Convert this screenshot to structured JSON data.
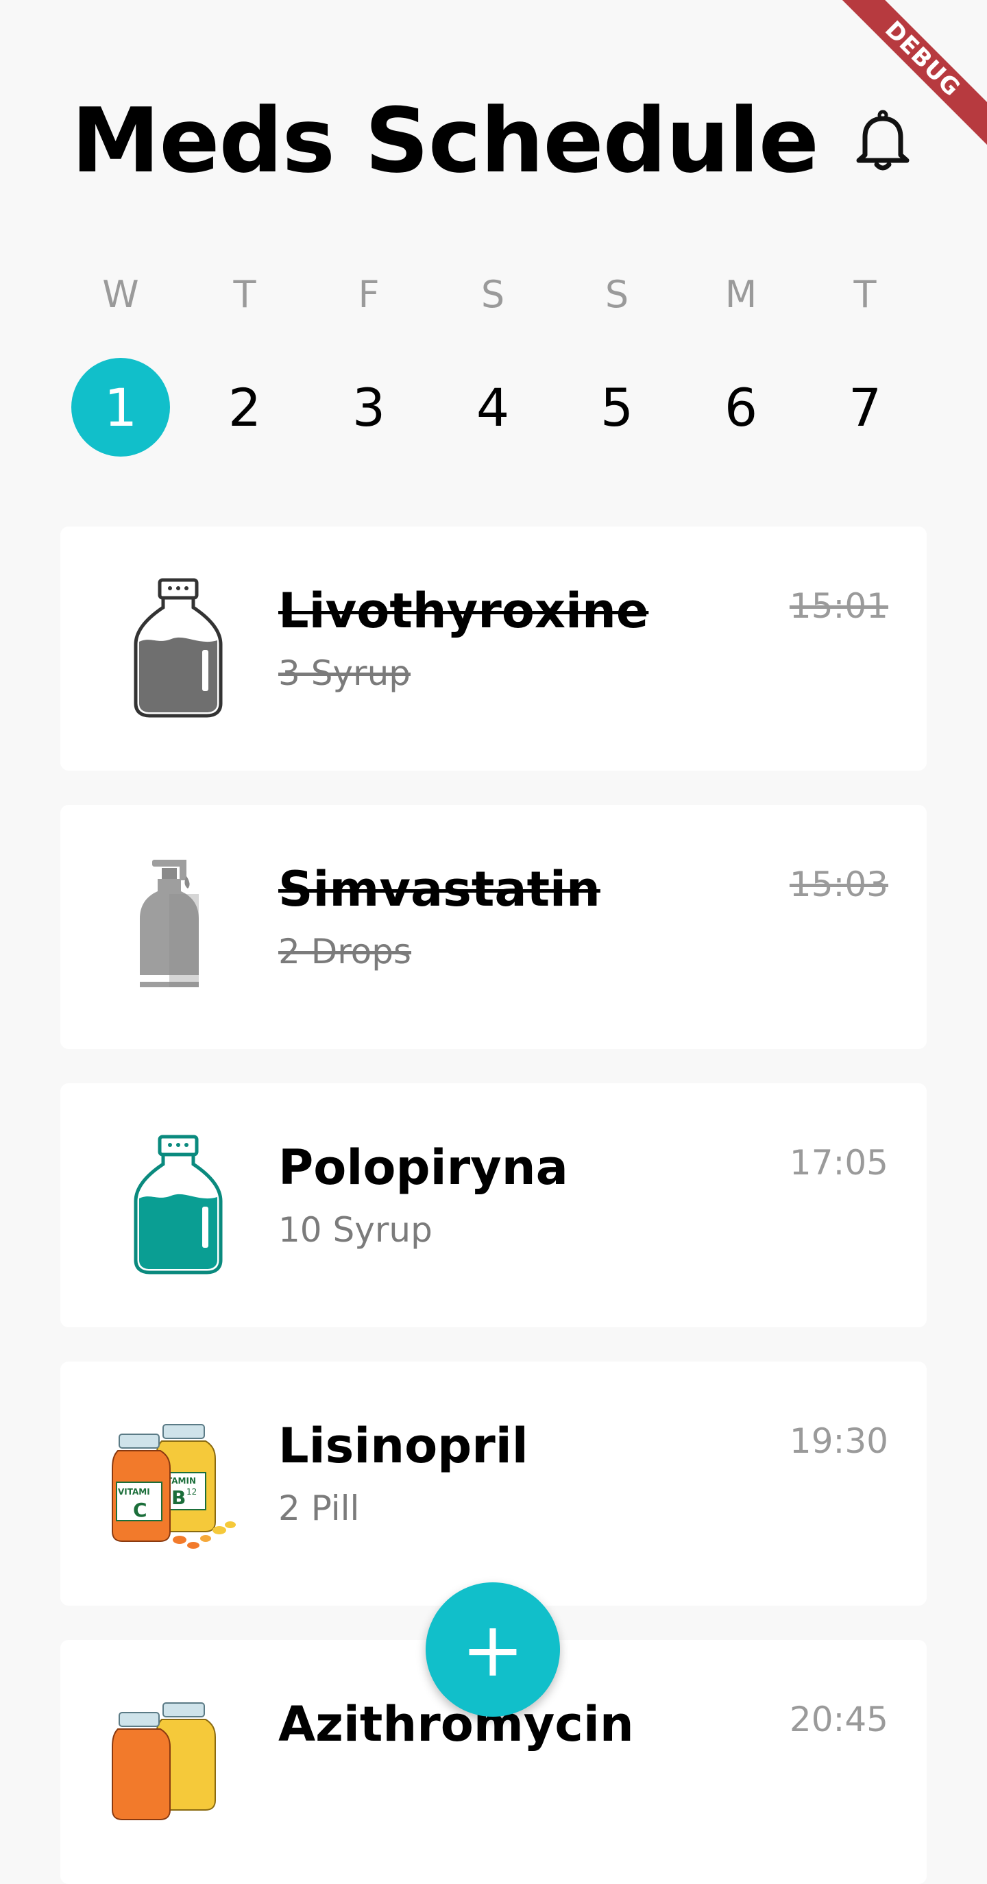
{
  "debug_banner": "DEBUG",
  "header": {
    "title": "Meds Schedule",
    "notification_icon": "bell-icon"
  },
  "calendar": {
    "days": [
      {
        "letter": "W",
        "number": "1",
        "selected": true
      },
      {
        "letter": "T",
        "number": "2",
        "selected": false
      },
      {
        "letter": "F",
        "number": "3",
        "selected": false
      },
      {
        "letter": "S",
        "number": "4",
        "selected": false
      },
      {
        "letter": "S",
        "number": "5",
        "selected": false
      },
      {
        "letter": "M",
        "number": "6",
        "selected": false
      },
      {
        "letter": "T",
        "number": "7",
        "selected": false
      }
    ]
  },
  "medications": [
    {
      "name": "Livothyroxine",
      "dose": "3 Syrup",
      "time": "15:01",
      "taken": true,
      "icon": "syrup-bottle-icon"
    },
    {
      "name": "Simvastatin",
      "dose": "2 Drops",
      "time": "15:03",
      "taken": true,
      "icon": "dropper-bottle-icon"
    },
    {
      "name": "Polopiryna",
      "dose": "10 Syrup",
      "time": "17:05",
      "taken": false,
      "icon": "syrup-bottle-icon"
    },
    {
      "name": "Lisinopril",
      "dose": "2 Pill",
      "time": "19:30",
      "taken": false,
      "icon": "vitamin-pills-icon"
    },
    {
      "name": "Azithromycin",
      "dose": "",
      "time": "20:45",
      "taken": false,
      "icon": "vitamin-pills-icon"
    }
  ],
  "fab": {
    "label": "+",
    "icon": "plus-icon"
  },
  "colors": {
    "accent": "#11bfca",
    "background": "#f8f8f8",
    "taken_icon": "#757575",
    "syrup_active": "#0a9e93",
    "debug_ribbon": "#b73a3f"
  }
}
